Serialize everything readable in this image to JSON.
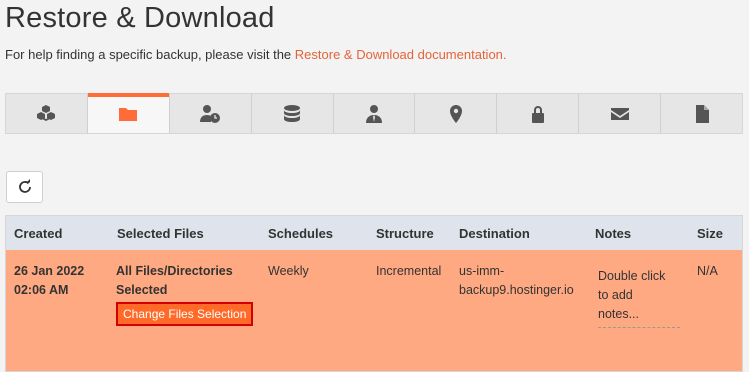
{
  "page": {
    "title": "Restore & Download",
    "help_prefix": "For help finding a specific backup, please visit the ",
    "help_link": "Restore & Download documentation."
  },
  "tabs": [
    {
      "name": "cubes-icon",
      "active": false
    },
    {
      "name": "folder-icon",
      "active": true
    },
    {
      "name": "user-clock-icon",
      "active": false
    },
    {
      "name": "database-icon",
      "active": false
    },
    {
      "name": "user-tie-icon",
      "active": false
    },
    {
      "name": "location-pin-icon",
      "active": false
    },
    {
      "name": "lock-icon",
      "active": false
    },
    {
      "name": "envelope-icon",
      "active": false
    },
    {
      "name": "file-icon",
      "active": false
    }
  ],
  "colors": {
    "accent": "#ff6c37",
    "row_highlight": "#ffa982",
    "header_bg": "#dfe4ec",
    "button_border": "#d40000"
  },
  "table": {
    "headers": {
      "created": "Created",
      "selected_files": "Selected Files",
      "schedules": "Schedules",
      "structure": "Structure",
      "destination": "Destination",
      "notes": "Notes",
      "size": "Size"
    },
    "row": {
      "created_date": "26 Jan 2022",
      "created_time": "02:06 AM",
      "selected_line1": "All Files/Directories",
      "selected_line2": "Selected",
      "change_button": "Change Files Selection",
      "schedules": "Weekly",
      "structure": "Incremental",
      "destination_line1": "us-imm-",
      "destination_line2": "backup9.hostinger.io",
      "notes_line1": "Double click",
      "notes_line2": "to add",
      "notes_line3": "notes...",
      "size": "N/A"
    }
  }
}
